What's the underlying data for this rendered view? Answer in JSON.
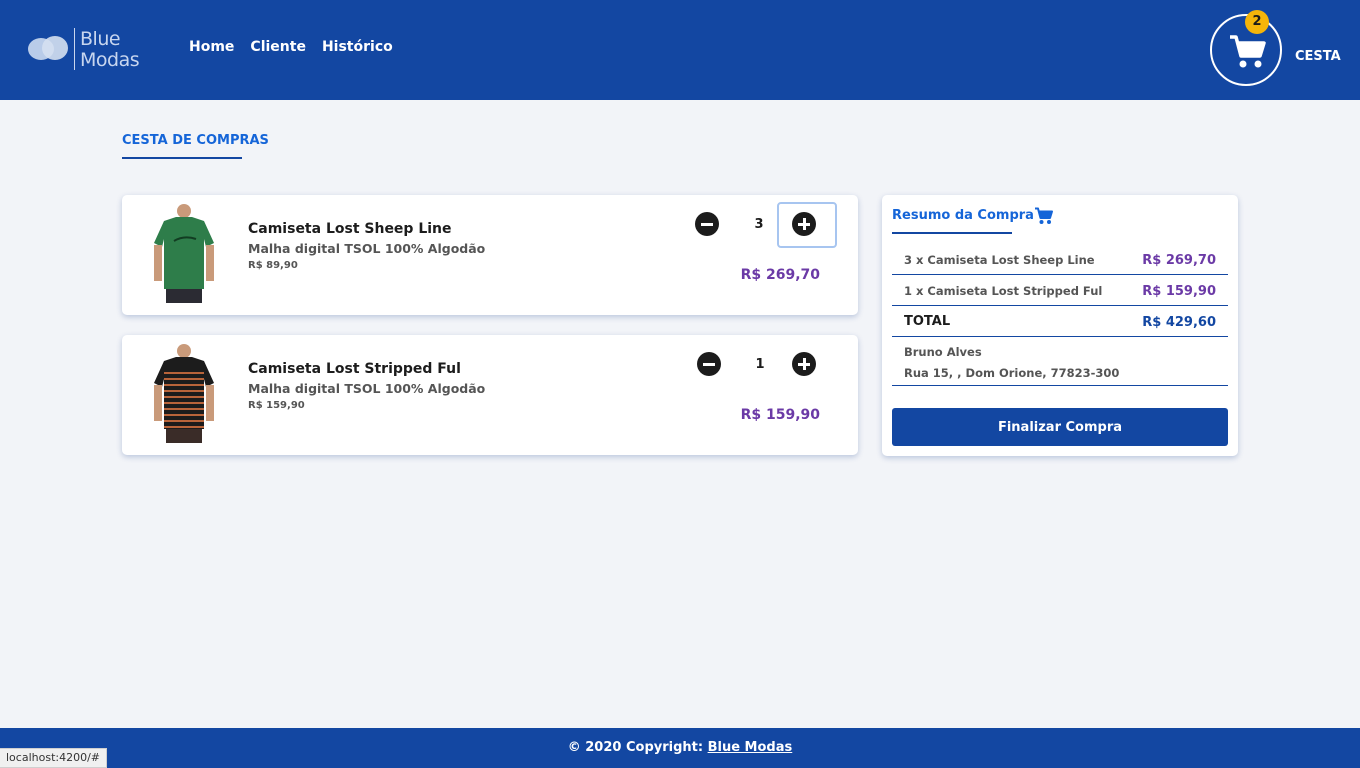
{
  "brand": {
    "line1": "Blue",
    "line2": "Modas"
  },
  "nav": [
    {
      "label": "Home"
    },
    {
      "label": "Cliente"
    },
    {
      "label": "Histórico"
    }
  ],
  "cart": {
    "count": "2",
    "label": "CESTA"
  },
  "page": {
    "title": "CESTA DE COMPRAS"
  },
  "items": [
    {
      "name": "Camiseta Lost Sheep Line",
      "description": "Malha digital TSOL 100% Algodão",
      "unit_price": "R$ 89,90",
      "quantity": "3",
      "line_total": "R$ 269,70",
      "shirt_color": "#2e7d4a"
    },
    {
      "name": "Camiseta Lost Stripped Ful",
      "description": "Malha digital TSOL 100% Algodão",
      "unit_price": "R$ 159,90",
      "quantity": "1",
      "line_total": "R$ 159,90",
      "shirt_color": "#1c1c1c"
    }
  ],
  "summary": {
    "title": "Resumo da Compra",
    "lines": [
      {
        "label": "3 x Camiseta Lost Sheep Line",
        "value": "R$ 269,70"
      },
      {
        "label": "1 x Camiseta Lost Stripped Ful",
        "value": "R$ 159,90"
      }
    ],
    "total_label": "TOTAL",
    "total_value": "R$ 429,60",
    "customer_name": "Bruno Alves",
    "customer_address": "Rua 15, , Dom Orione, 77823-300",
    "finish_label": "Finalizar Compra"
  },
  "footer": {
    "copyright": "© 2020 Copyright: ",
    "link": "Blue Modas"
  },
  "status_url": "localhost:4200/#",
  "colors": {
    "primary": "#1347a2",
    "accent": "#1565d8",
    "price": "#6b3aa6",
    "badge": "#f5b50a"
  }
}
